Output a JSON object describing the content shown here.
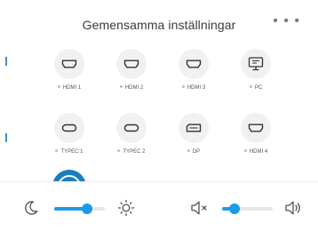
{
  "header": {
    "title": "Gemensamma inställningar",
    "more_label": "• • •"
  },
  "sources": [
    {
      "label": "HDMI 1",
      "icon": "hdmi-icon"
    },
    {
      "label": "HDMI 2",
      "icon": "hdmi-icon"
    },
    {
      "label": "HDMI 3",
      "icon": "hdmi-icon"
    },
    {
      "label": "PC",
      "icon": "monitor-icon"
    },
    {
      "label": "TYPEC 1",
      "icon": "usb-c-icon"
    },
    {
      "label": "TYPEC 2",
      "icon": "usb-c-icon"
    },
    {
      "label": "DP",
      "icon": "displayport-icon"
    },
    {
      "label": "HDMI 4",
      "icon": "hdmi-icon"
    }
  ],
  "controls": {
    "brightness": {
      "value": 0.65,
      "low_icon": "moon-icon",
      "high_icon": "sun-icon"
    },
    "volume": {
      "value": 0.25,
      "low_icon": "mute-icon",
      "high_icon": "speaker-icon"
    }
  },
  "colors": {
    "accent": "#1a9be6",
    "icon": "#333333",
    "icon_bg": "#f1f1f1"
  }
}
